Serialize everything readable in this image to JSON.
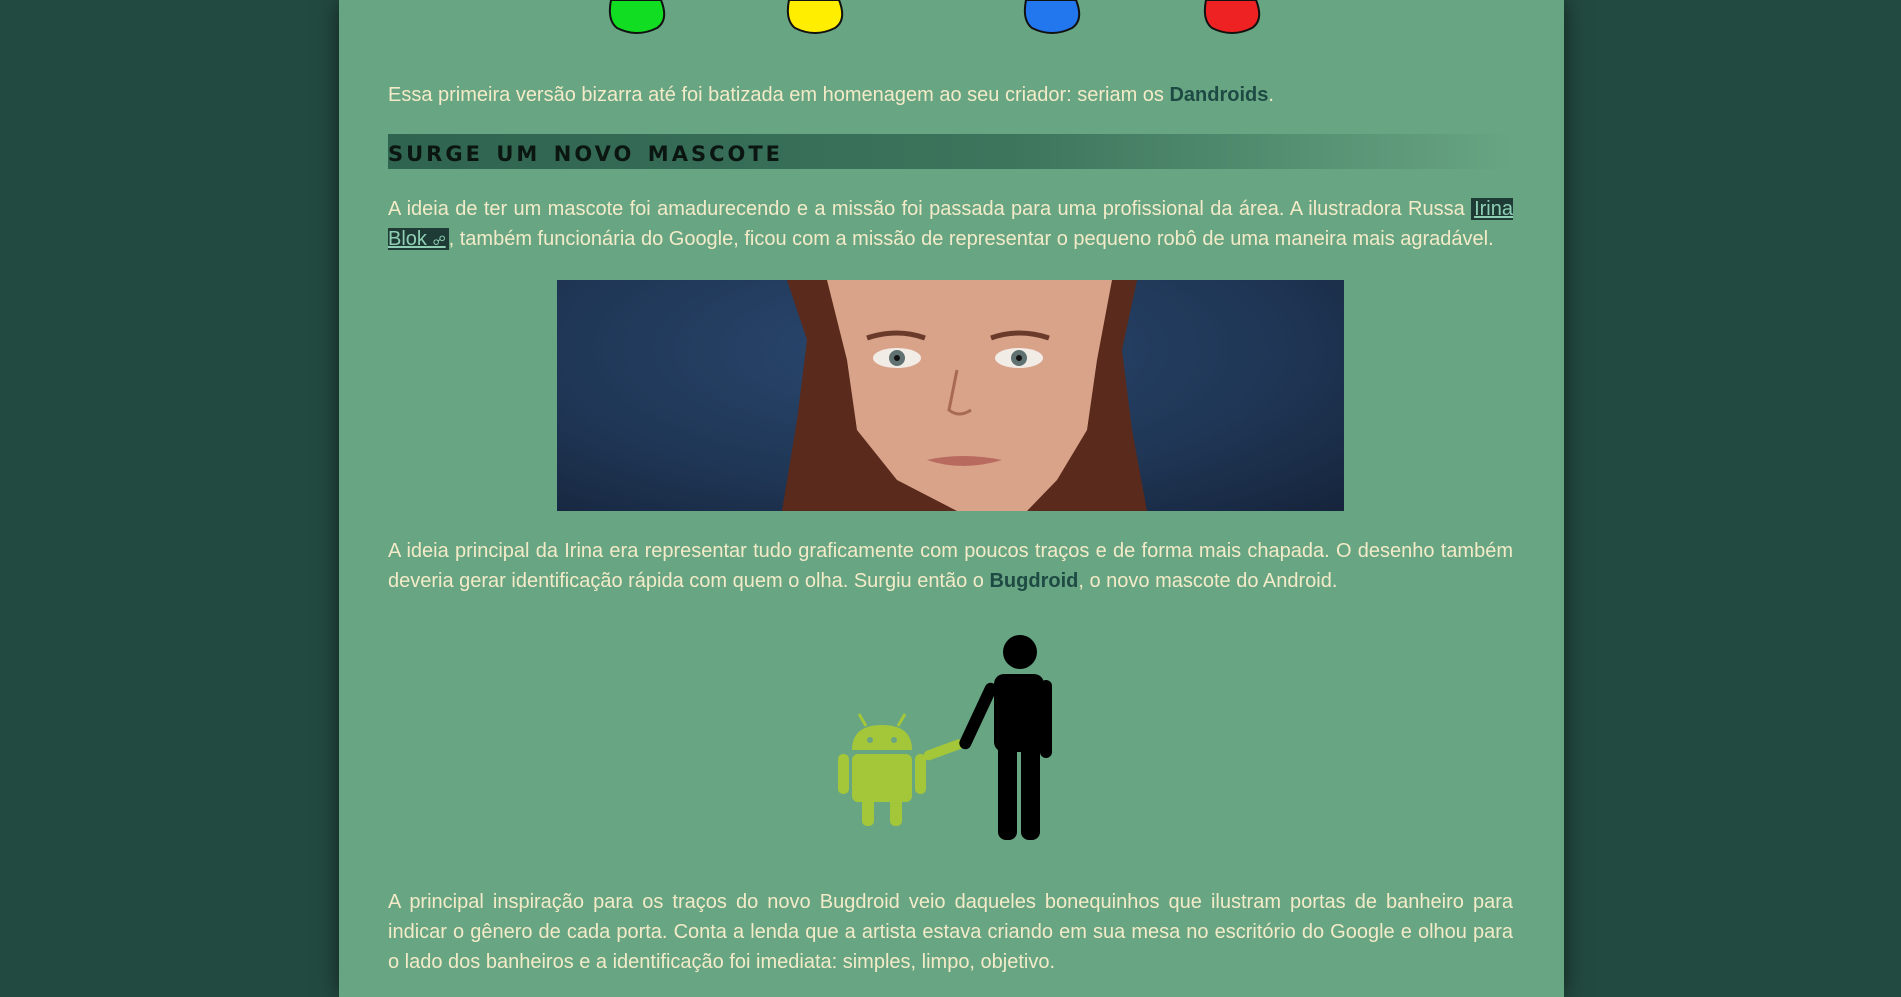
{
  "article": {
    "p_dandroids_before": "Essa primeira versão bizarra até foi batizada em homenagem ao seu criador: seriam os ",
    "p_dandroids_link": "Dandroids",
    "p_dandroids_after": ".",
    "heading": "Surge um novo mascote",
    "p_irina_before": "A ideia de ter um mascote foi amadurecendo e a missão foi passada para uma profissional da área. A ilustradora Russa ",
    "p_irina_link": "Irina Blok",
    "p_irina_after": ", também funcionária do Google, ficou com a missão de representar o pequeno robô de uma maneira mais agradável.",
    "p_bug_before": "A ideia principal da Irina era representar tudo graficamente com poucos traços e de forma mais chapada. O desenho também deveria gerar identificação rápida com quem o olha. Surgiu então o ",
    "p_bug_link": "Bugdroid",
    "p_bug_after": ", o novo mascote do Android.",
    "p_insp": "A principal inspiração para os traços do novo Bugdroid veio daqueles bonequinhos que ilustram portas de banheiro para indicar o gênero de cada porta. Conta a lenda que a artista estava criando em sua mesa no escritório do Google e olhou para o lado dos banheiros e a identificação foi imediata: simples, limpo, objetivo."
  },
  "colors": {
    "page_background": "#68a583",
    "outer_background": "#234a40",
    "body_text": "#f3ebc8",
    "link_text": "#1e4a44",
    "android_green": "#a4c639",
    "shape_colors": [
      "#11dd22",
      "#ffee00",
      "#2277ee",
      "#ee2222"
    ]
  },
  "icons": {
    "external_link": "external-link-icon"
  }
}
